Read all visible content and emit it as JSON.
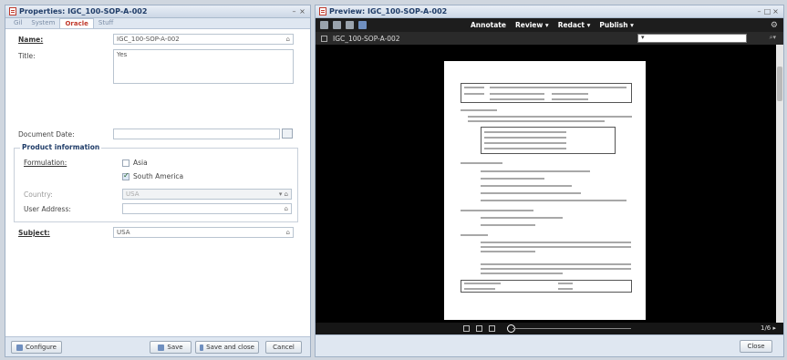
{
  "left_panel": {
    "title": "Properties: IGC_100-SOP-A-002",
    "controls": [
      "–",
      "×"
    ],
    "tabs": [
      {
        "label": "Gil",
        "active": false
      },
      {
        "label": "System",
        "active": false
      },
      {
        "label": "Oracle",
        "active": true
      },
      {
        "label": "Stuff",
        "active": false
      }
    ],
    "fields": {
      "name": {
        "label": "Name:",
        "value": "IGC_100-SOP-A-002"
      },
      "title": {
        "label": "Title:",
        "value": "Yes"
      },
      "document_date": {
        "label": "Document Date:",
        "value": ""
      },
      "product_info_legend": "Product information",
      "formulation": {
        "label": "Formulation:",
        "options": [
          {
            "label": "Asia",
            "checked": false
          },
          {
            "label": "South America",
            "checked": true
          }
        ]
      },
      "country": {
        "label": "Country:",
        "value": "USA"
      },
      "user_address": {
        "label": "User Address:",
        "value": ""
      },
      "subject": {
        "label": "Subject:",
        "value": "USA"
      }
    },
    "footer": {
      "configure": "Configure",
      "save": "Save",
      "save_close": "Save and close",
      "cancel": "Cancel"
    }
  },
  "right_panel": {
    "title": "Preview: IGC_100-SOP-A-002",
    "controls": [
      "–",
      "□",
      "×"
    ],
    "toolbar": {
      "menus": [
        "Annotate",
        "Review ▾",
        "Redact ▾",
        "Publish ▾"
      ]
    },
    "doc_tab": "IGC_100-SOP-A-002",
    "page_indicator": "1/6",
    "footer": {
      "close": "Close"
    }
  }
}
